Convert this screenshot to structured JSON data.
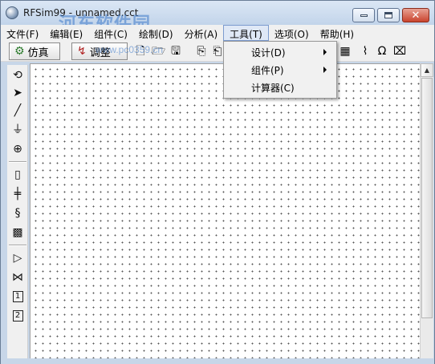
{
  "window": {
    "title": "RFSim99 - unnamed.cct",
    "watermark_text": "河东软件园",
    "watermark_url": "www.pc0359.cn"
  },
  "menubar": {
    "items": [
      {
        "label": "文件(F)"
      },
      {
        "label": "编辑(E)"
      },
      {
        "label": "组件(C)"
      },
      {
        "label": "绘制(D)"
      },
      {
        "label": "分析(A)"
      },
      {
        "label": "工具(T)",
        "active": true
      },
      {
        "label": "选项(O)"
      },
      {
        "label": "帮助(H)"
      }
    ]
  },
  "toolbar": {
    "simulate_label": "仿真",
    "tune_label": "调整",
    "icons": [
      "new-document-icon",
      "open-folder-icon",
      "save-disk-icon",
      "component-icon",
      "component-icon",
      "calculator-icon",
      "antenna-icon",
      "omega-icon",
      "template-icon"
    ]
  },
  "palette": {
    "tools": [
      "rotate-icon",
      "pointer-arrow-icon",
      "wire-line-icon",
      "ground-icon",
      "source-icon",
      "resistor-icon",
      "capacitor-icon",
      "inductor-icon",
      "transmission-line-icon",
      "amplifier-icon",
      "transformer-icon",
      "one-port-icon",
      "two-port-icon"
    ],
    "port_labels": [
      "1",
      "2"
    ]
  },
  "tools_menu": {
    "items": [
      {
        "label": "设计(D)",
        "has_submenu": true
      },
      {
        "label": "组件(P)",
        "has_submenu": true
      },
      {
        "label": "计算器(C)",
        "has_submenu": false
      }
    ]
  },
  "colors": {
    "frame": "#c7d6e8",
    "menu_bg": "#f0f0f0",
    "close_button": "#c9442e",
    "active_menu_highlight": "#dfe8f6"
  }
}
